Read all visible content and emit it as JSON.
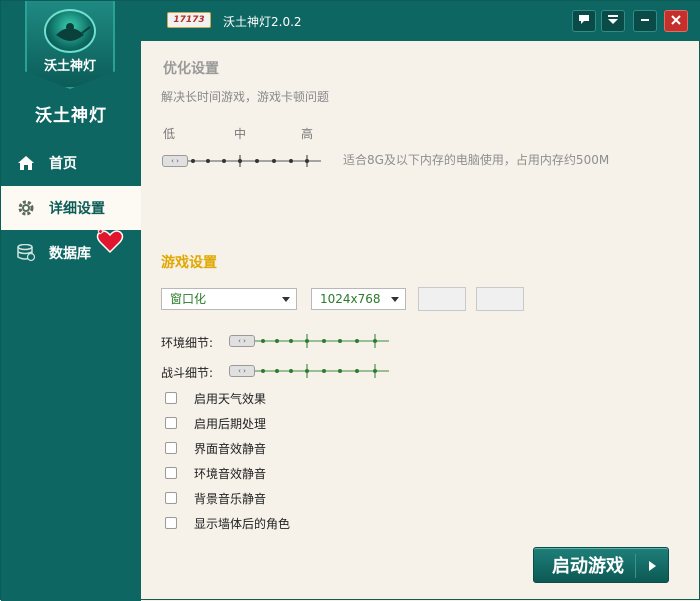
{
  "titlebar": {
    "title": "沃土神灯2.0.2",
    "logo_text": "17173"
  },
  "sidebar": {
    "logo_text": "沃土神灯",
    "app_title": "沃土神灯",
    "items": [
      {
        "label": "首页",
        "icon": "home-icon"
      },
      {
        "label": "详细设置",
        "icon": "gear-icon"
      },
      {
        "label": "数据库",
        "icon": "database-icon"
      }
    ]
  },
  "optimize": {
    "title": "优化设置",
    "desc": "解决长时间游戏，游戏卡顿问题",
    "levels": [
      "低",
      "中",
      "高"
    ],
    "knob_text": "‹ ›",
    "note": "适合8G及以下内存的电脑使用，占用内存约500M"
  },
  "game": {
    "title": "游戏设置",
    "mode_value": "窗口化",
    "resolution_value": "1024x768",
    "env_detail_label": "环境细节:",
    "battle_detail_label": "战斗细节:",
    "checkboxes": [
      "启用天气效果",
      "启用后期处理",
      "界面音效静音",
      "环境音效静音",
      "背景音乐静音",
      "显示墙体后的角色"
    ]
  },
  "start_button": "启动游戏",
  "colors": {
    "primary": "#0e6662",
    "accent_title": "#e0a800",
    "background": "#f6f2ea"
  }
}
